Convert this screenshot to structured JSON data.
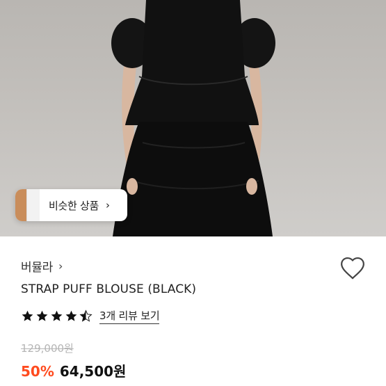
{
  "similar": {
    "label": "비슷한 상품",
    "arrow": "›"
  },
  "product": {
    "brand": "버뮬라",
    "brand_chevron": "›",
    "name": "STRAP PUFF BLOUSE (BLACK)",
    "rating": 4.5,
    "review_link": "3개 리뷰 보기",
    "original_price": "129,000원",
    "discount": "50%",
    "sale_price": "64,500원"
  },
  "colors": {
    "accent": "#ff4b1f",
    "text": "#111111",
    "muted": "#b5b5b5"
  },
  "icons": {
    "heart": "heart-icon",
    "star": "star-icon"
  }
}
